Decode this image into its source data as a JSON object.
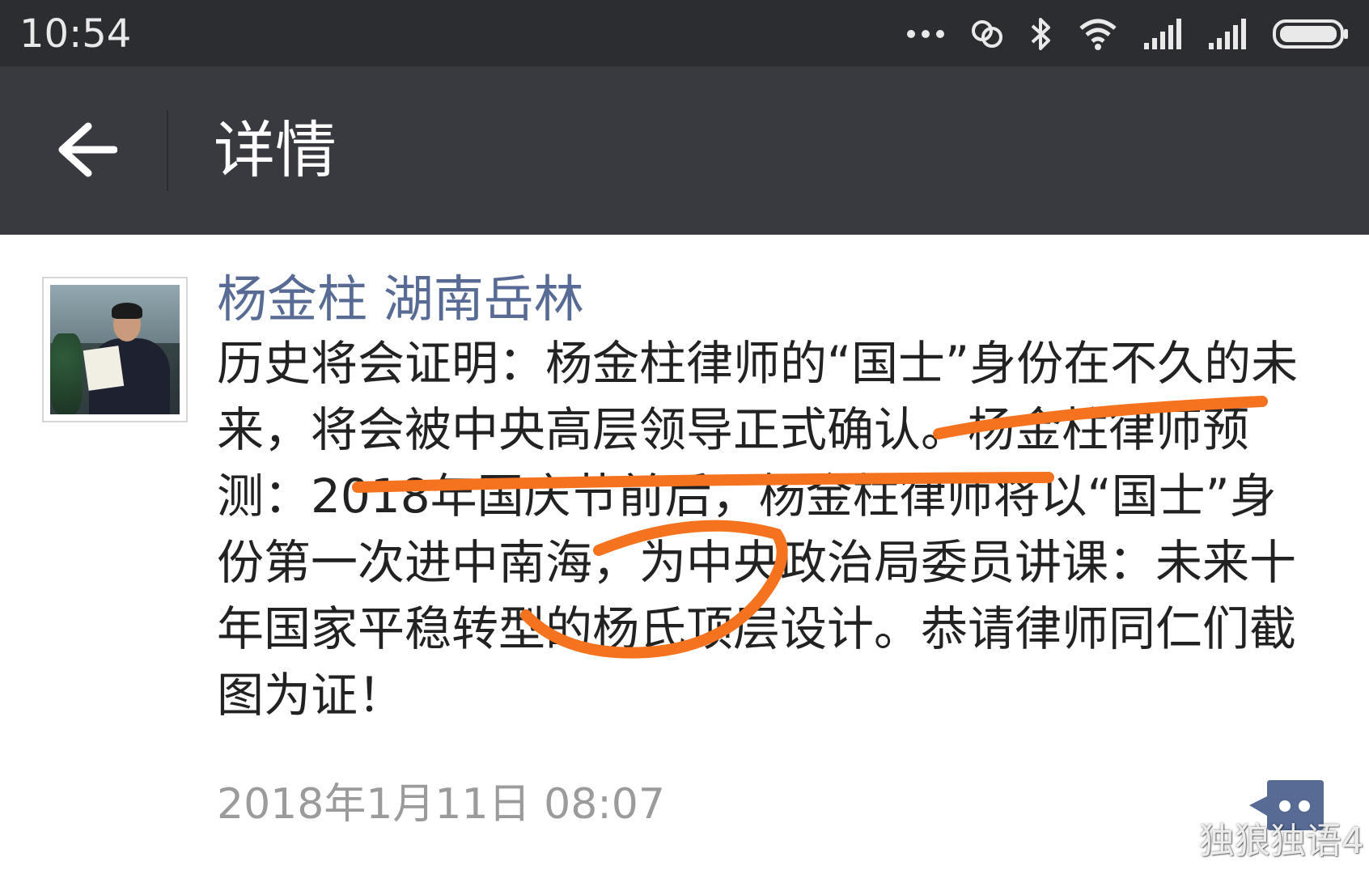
{
  "status_bar": {
    "time": "10:54",
    "icons": [
      "more-dots-icon",
      "sync-icon",
      "bluetooth-icon",
      "wifi-icon",
      "signal-icon",
      "signal-icon",
      "battery-icon"
    ]
  },
  "header": {
    "back_icon": "arrow-left-icon",
    "title": "详情"
  },
  "post": {
    "author": "杨金柱 湖南岳林",
    "text": "历史将会证明：杨金柱律师的“国士”身份在不久的未来，将会被中央高层领导正式确认。杨金柱律师预测：2018年国庆节前后，杨金柱律师将以“国士”身份第一次进中南海，为中央政治局委员讲课：未来十年国家平稳转型的杨氏顶层设计。恭请律师同仁们截图为证！",
    "timestamp": "2018年1月11日 08:07",
    "comment_icon": "comment-icon"
  },
  "watermark": {
    "logo_icon": "weibo-icon",
    "text": "独狼独语4"
  },
  "colors": {
    "status_bar": "#2b2d31",
    "title_bar": "#393a40",
    "author_link": "#576b95",
    "timestamp": "#9b9b9b",
    "annotation_stroke": "#f5731f",
    "comment_icon": "#576b95"
  }
}
